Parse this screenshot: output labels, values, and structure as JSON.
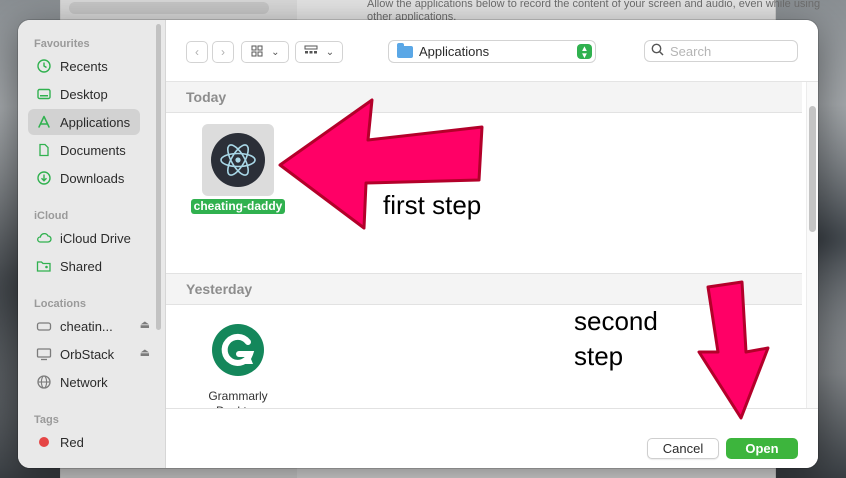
{
  "background": {
    "description_text": "Allow the applications below to record the content of your screen and audio, even while using other applications."
  },
  "sidebar": {
    "sections": [
      {
        "title": "Favourites",
        "items": [
          {
            "label": "Recents",
            "icon": "clock-icon"
          },
          {
            "label": "Desktop",
            "icon": "desktop-icon"
          },
          {
            "label": "Applications",
            "icon": "applications-icon",
            "active": true
          },
          {
            "label": "Documents",
            "icon": "document-icon"
          },
          {
            "label": "Downloads",
            "icon": "download-icon"
          }
        ]
      },
      {
        "title": "iCloud",
        "items": [
          {
            "label": "iCloud Drive",
            "icon": "cloud-icon"
          },
          {
            "label": "Shared",
            "icon": "shared-folder-icon"
          }
        ]
      },
      {
        "title": "Locations",
        "items": [
          {
            "label": "cheatin...",
            "icon": "drive-icon",
            "eject": true
          },
          {
            "label": "OrbStack",
            "icon": "display-icon",
            "eject": true
          },
          {
            "label": "Network",
            "icon": "globe-icon"
          }
        ]
      },
      {
        "title": "Tags",
        "items": [
          {
            "label": "Red",
            "icon": "tag-dot-icon",
            "color": "#e54545"
          }
        ]
      }
    ]
  },
  "toolbar": {
    "location": "Applications",
    "search_placeholder": "Search"
  },
  "content": {
    "groups": [
      {
        "title": "Today",
        "apps": [
          {
            "label": "cheating-daddy",
            "selected": true
          }
        ]
      },
      {
        "title": "Yesterday",
        "apps": [
          {
            "label": "Grammarly Desktop",
            "selected": false
          }
        ]
      }
    ]
  },
  "footer": {
    "cancel_label": "Cancel",
    "open_label": "Open"
  },
  "annotations": {
    "first_step": "first step",
    "second_step_line1": "second",
    "second_step_line2": "step",
    "arrow_color": "#ff0066"
  },
  "colors": {
    "accent": "#30b14f",
    "open_button": "#3db53d"
  }
}
